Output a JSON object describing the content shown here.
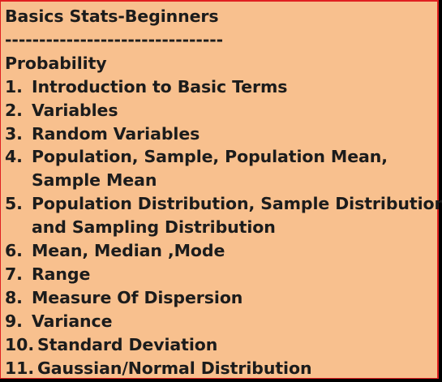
{
  "title": "Basics Stats-Beginners",
  "divider": "--------------------------------",
  "section_heading": "Probability",
  "items": [
    {
      "number": "1.",
      "lines": [
        "Introduction to Basic Terms"
      ]
    },
    {
      "number": "2.",
      "lines": [
        "Variables"
      ]
    },
    {
      "number": "3.",
      "lines": [
        "Random Variables"
      ]
    },
    {
      "number": "4.",
      "lines": [
        "Population, Sample, Population Mean,",
        "Sample Mean"
      ]
    },
    {
      "number": "5.",
      "lines": [
        "Population Distribution, Sample Distribution",
        "and Sampling Distribution"
      ]
    },
    {
      "number": "6.",
      "lines": [
        "Mean, Median ,Mode"
      ]
    },
    {
      "number": "7.",
      "lines": [
        "Range"
      ]
    },
    {
      "number": "8.",
      "lines": [
        "Measure Of Dispersion"
      ]
    },
    {
      "number": "9.",
      "lines": [
        "Variance"
      ]
    },
    {
      "number": "10.",
      "lines": [
        "Standard Deviation"
      ]
    },
    {
      "number": "11.",
      "lines": [
        "Gaussian/Normal Distribution"
      ]
    }
  ],
  "colors": {
    "background": "#f8c08e",
    "border": "#e02020",
    "text": "#1c1c1c"
  }
}
